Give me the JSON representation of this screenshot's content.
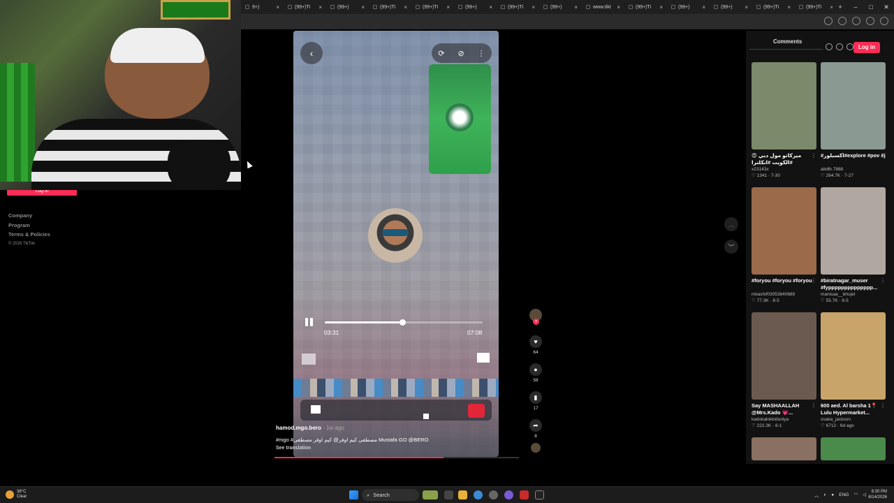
{
  "browser": {
    "tabs": [
      {
        "label": "9+)"
      },
      {
        "label": "(99+)Ti"
      },
      {
        "label": "(99+)"
      },
      {
        "label": "(99+)Ti"
      },
      {
        "label": "(99+)Ti"
      },
      {
        "label": "(99+)"
      },
      {
        "label": "(99+)Ti"
      },
      {
        "label": "(99+)"
      },
      {
        "label": "www.tikt"
      },
      {
        "label": "(99+)Ti"
      },
      {
        "label": "(99+)"
      },
      {
        "label": "(99+)"
      },
      {
        "label": "(99+)Ti"
      },
      {
        "label": "(99+)Ti"
      }
    ],
    "new_tab_icon": "+",
    "minimize_icon": "–",
    "maximize_icon": "□",
    "close_icon": "✕"
  },
  "webcam": {
    "login_label": "Log in"
  },
  "left_links": {
    "company": "Company",
    "program": "Program",
    "terms": "Terms & Policies",
    "copyright": "© 2026 TikTok"
  },
  "player": {
    "back_icon": "‹",
    "control_icons": [
      "⟳",
      "⊘",
      "⋮"
    ],
    "current_time": "03:31",
    "duration": "07:08",
    "progress": 0.49,
    "author": "hamod.mgo.bero",
    "age": " · 1w ago",
    "caption": "#mgo #مصطفى كيم اوفر@ كيم اوفر مصطفى Mustafa GO @BERO",
    "see_translation": "See translation",
    "page_progress": 0.69
  },
  "actions": {
    "plus": "+",
    "like_icon": "♥",
    "like_count": "64",
    "comment_icon": "●",
    "comment_count": "58",
    "save_icon": "▮",
    "save_count": "17",
    "share_icon": "➦",
    "share_count": "8"
  },
  "scroll": {
    "up_icon": "︿",
    "down_icon": "﹀"
  },
  "right_panel": {
    "comments_tab": "Comments",
    "login_label": "Log in",
    "cards": [
      {
        "title": "😍 ميركاتو مول دبي #الكويت #انكلترا",
        "user": "x23143x",
        "meta": "♡ 1341 · 7-30",
        "color": "#7a8a6a"
      },
      {
        "title": "#اكسبلور#explore #pov #j",
        "user": "abdlh.7888",
        "meta": "♡ 264.7K · 7-27",
        "color": "#8a9a92"
      },
      {
        "title": "#foryou #foryou #foryou",
        "user": "mkashif03053840689",
        "meta": "♡ 77.3K · 8-5",
        "color": "#9a6a4a"
      },
      {
        "title": "#biratnagar_muser #fypppppppppppppp...",
        "user": "manisaa__bhujel",
        "meta": "♡ 55.7K · 8-5",
        "color": "#b0a8a0"
      },
      {
        "title": "Say MASHAALLAH @Mrs.Kado 💗...",
        "user": "kadokalokkiduniya",
        "meta": "♡ 222.3K · 8-1",
        "color": "#6a5a50"
      },
      {
        "title": "600 aed. Al barsha 1📍 Lulu Hypermarket...",
        "user": "osaka_jackson",
        "meta": "♡ 6712 · 6d ago",
        "color": "#c9a46a"
      },
      {
        "title": "",
        "user": "",
        "meta": "",
        "color": "#8a7060"
      },
      {
        "title": "",
        "user": "",
        "meta": "",
        "color": "#4a8a4a"
      }
    ]
  },
  "taskbar": {
    "temp": "38°C",
    "weather": "Clear",
    "search_label": "Search",
    "lang": "ENG",
    "time": "8:30 PM",
    "date": "8/14/2026"
  }
}
